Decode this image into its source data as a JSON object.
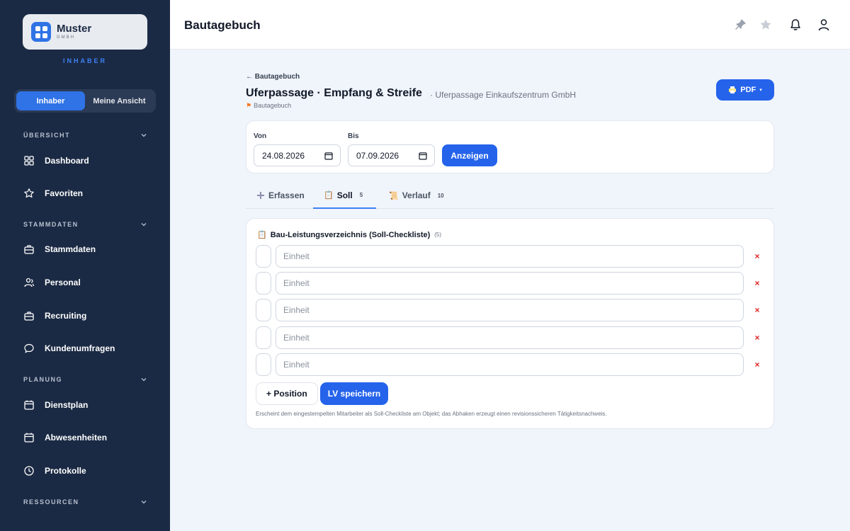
{
  "sidebar": {
    "brand_name": "Muster",
    "brand_sub": "GMBH",
    "role_label": "INHABER",
    "toggle": [
      "Inhaber",
      "Meine Ansicht"
    ],
    "sections": {
      "uebersicht": "ÜBERSICHT",
      "stammdaten": "STAMMDATEN",
      "planung": "PLANUNG",
      "ressourcen": "RESSOURCEN"
    },
    "items": {
      "dashboard": "Dashboard",
      "favoriten": "Favoriten",
      "stammdaten": "Stammdaten",
      "personal": "Personal",
      "recruiting": "Recruiting",
      "kundenumfragen": "Kundenumfragen",
      "dienstplan": "Dienstplan",
      "abwesenheiten": "Abwesenheiten",
      "protokolle": "Protokolle"
    }
  },
  "header": {
    "title": "Bautagebuch",
    "icons": [
      "pin-icon",
      "star-icon",
      "bell-icon",
      "user-icon"
    ]
  },
  "page": {
    "back_link": "← Bautagebuch",
    "title": "Uferpassage · Empfang & Streife",
    "subtitle": "· Uferpassage Einkaufszentrum GmbH",
    "crumb": "Bautagebuch",
    "pdf_label": "PDF",
    "pdf_caret": "▾"
  },
  "filter": {
    "von_label": "Von",
    "von_value": "24.08.2026",
    "bis_label": "Bis",
    "bis_value": "07.09.2026",
    "show_label": "Anzeigen"
  },
  "tabs": [
    {
      "label": "Erfassen",
      "badge": ""
    },
    {
      "label": "Soll",
      "badge": "5"
    },
    {
      "label": "Verlauf",
      "badge": "10"
    }
  ],
  "lv": {
    "title": "Bau-Leistungsverzeichnis (Soll-Checkliste)",
    "count": "(5)",
    "rows": [
      {
        "placeholder": "Einheit"
      },
      {
        "placeholder": "Einheit"
      },
      {
        "placeholder": "Einheit"
      },
      {
        "placeholder": "Einheit"
      },
      {
        "placeholder": "Einheit"
      }
    ],
    "remove_glyph": "×",
    "add_label": "+ Position",
    "save_label": "LV speichern",
    "hint": "Erscheint dem eingestempelten Mitarbeiter als Soll-Checkliste am Objekt; das Abhaken erzeugt einen revisionssicheren Tätigkeitsnachweis."
  },
  "colors": {
    "sidebar_bg": "#1b2a44",
    "accent": "#2563eb",
    "danger": "#dc2626"
  }
}
